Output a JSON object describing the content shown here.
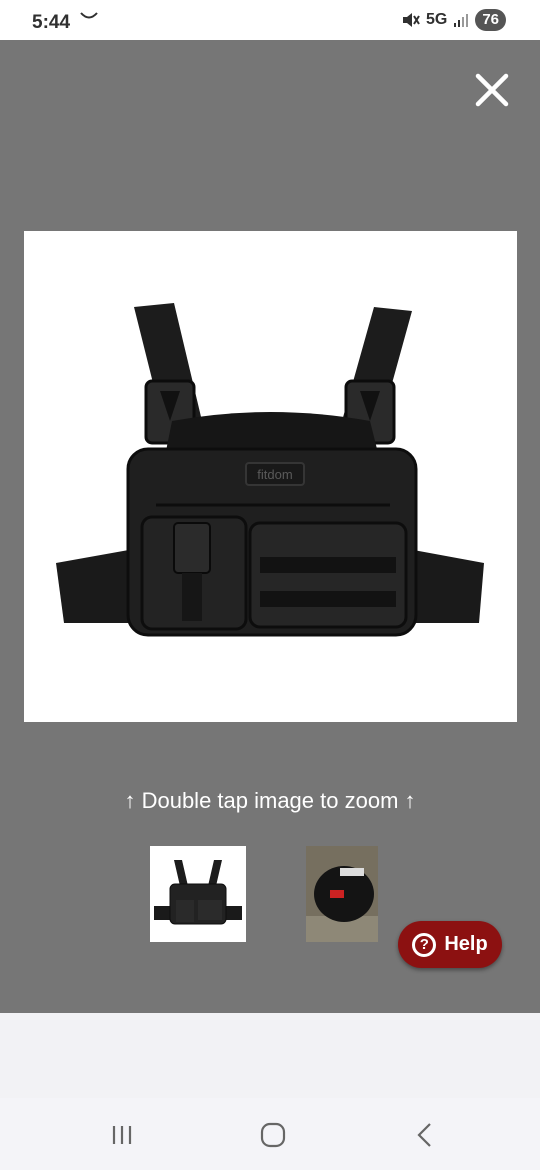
{
  "status_bar": {
    "time": "5:44",
    "network": "5G",
    "battery": "76",
    "icons": [
      "notification-swoosh-icon",
      "mute-vibrate-icon",
      "signal-icon"
    ]
  },
  "viewer": {
    "close_icon": "close-icon",
    "zoom_hint": "↑ Double tap image to zoom ↑",
    "main_image": {
      "alt": "Black chest rig bag with shoulder straps and buckles",
      "logo_text": "fitdom"
    },
    "thumbnails": [
      {
        "alt": "Chest rig bag thumbnail"
      },
      {
        "alt": "Packaged item photo thumbnail"
      }
    ]
  },
  "help_button": {
    "label": "Help",
    "icon": "question-icon"
  },
  "nav_bar": {
    "recents_icon": "recents-icon",
    "home_icon": "home-icon",
    "back_icon": "back-icon"
  },
  "colors": {
    "overlay": "#767676",
    "help_bg": "#8c1111",
    "bag": "#1e1e1e"
  }
}
